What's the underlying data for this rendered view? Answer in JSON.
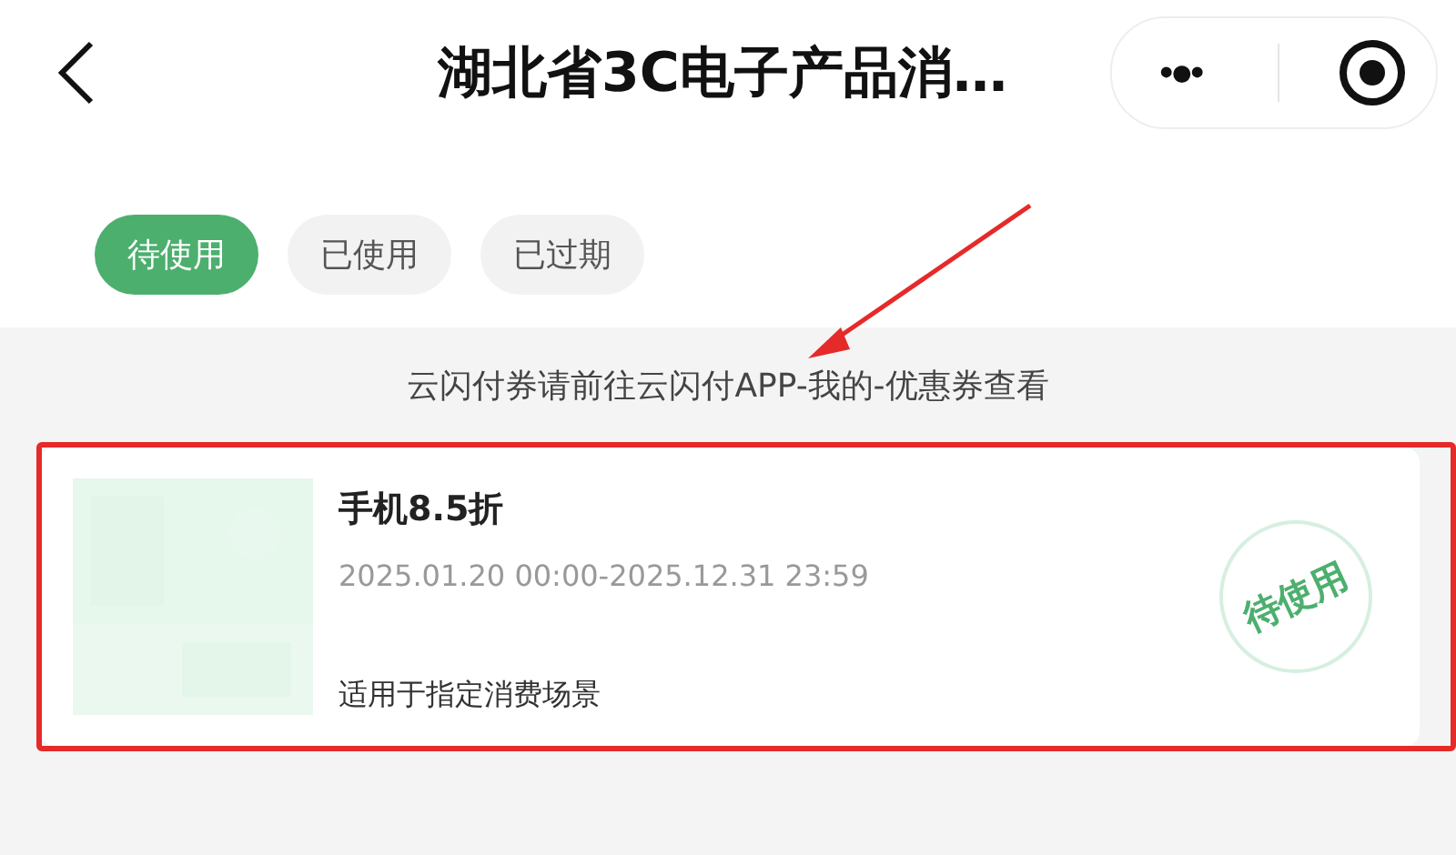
{
  "nav": {
    "title": "湖北省3C电子产品消…",
    "more_glyph": "•●•"
  },
  "tabs": [
    {
      "label": "待使用",
      "selected": true
    },
    {
      "label": "已使用",
      "selected": false
    },
    {
      "label": "已过期",
      "selected": false
    }
  ],
  "notice": "云闪付券请前往云闪付APP-我的-优惠券查看",
  "coupons": [
    {
      "title": "手机8.5折",
      "validity": "2025.01.20 00:00-2025.12.31 23:59",
      "scope": "适用于指定消费场景",
      "stamp": "待使用",
      "highlighted": true
    }
  ],
  "annotations": {
    "arrow": true
  }
}
